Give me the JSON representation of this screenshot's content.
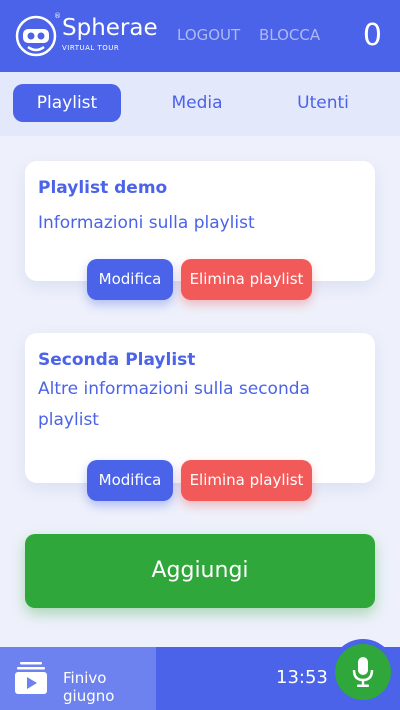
{
  "header": {
    "logo_name": "Spherae",
    "logo_sub": "VIRTUAL TOUR",
    "logo_mark": "®",
    "logout_label": "LOGOUT",
    "blocca_label": "BLOCCA",
    "counter": "0"
  },
  "tabs": [
    {
      "label": "Playlist",
      "active": true
    },
    {
      "label": "Media",
      "active": false
    },
    {
      "label": "Utenti",
      "active": false
    }
  ],
  "playlists": [
    {
      "title": "Playlist demo",
      "description": "Informazioni sulla playlist",
      "edit_label": "Modifica",
      "delete_label": "Elimina playlist"
    },
    {
      "title": "Seconda Playlist",
      "description": "Altre informazioni sulla seconda playlist",
      "edit_label": "Modifica",
      "delete_label": "Elimina playlist"
    }
  ],
  "add_label": "Aggiungi",
  "footer": {
    "media_label": "Finivo giugno",
    "time": "13:53",
    "media_icon": "media-playlist-icon",
    "mic_icon": "microphone-icon"
  },
  "colors": {
    "primary": "#4a63e8",
    "danger": "#f25a5a",
    "success": "#2fa73a",
    "background": "#eef1fb"
  }
}
